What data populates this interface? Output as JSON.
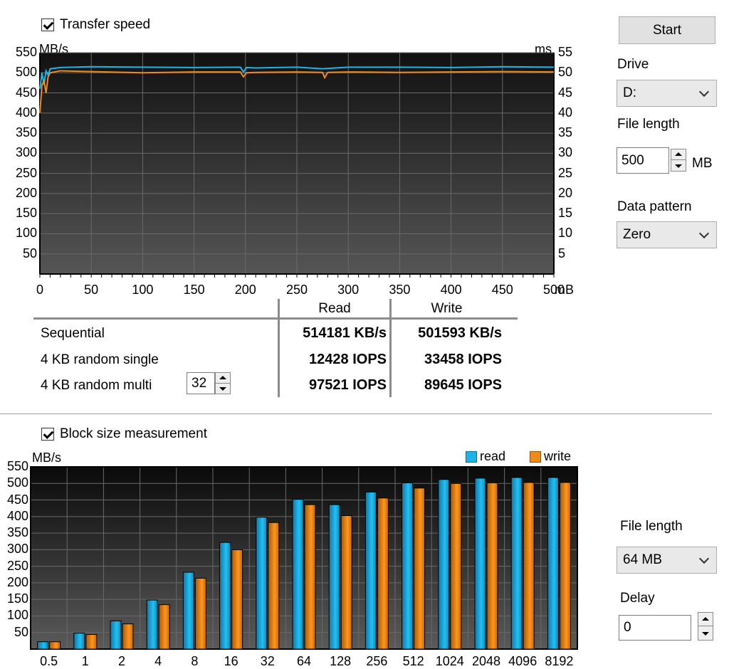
{
  "transfer": {
    "checkbox_label": "Transfer speed",
    "ylabel_left": "MB/s",
    "ylabel_right": "ms",
    "x_unit": "mB",
    "left_ticks": [
      "550",
      "500",
      "450",
      "400",
      "350",
      "300",
      "250",
      "200",
      "150",
      "100",
      "50"
    ],
    "right_ticks": [
      "55",
      "50",
      "45",
      "40",
      "35",
      "30",
      "25",
      "20",
      "15",
      "10",
      "5"
    ],
    "x_ticks": [
      "0",
      "50",
      "100",
      "150",
      "200",
      "250",
      "300",
      "350",
      "400",
      "450",
      "500"
    ]
  },
  "results": {
    "read_header": "Read",
    "write_header": "Write",
    "rows": [
      {
        "label": "Sequential",
        "read": "514181 KB/s",
        "write": "501593 KB/s"
      },
      {
        "label": "4 KB random single",
        "read": "12428 IOPS",
        "write": "33458 IOPS"
      },
      {
        "label": "4 KB random multi",
        "read": "97521 IOPS",
        "write": "89645 IOPS"
      }
    ],
    "queue_depth": "32"
  },
  "controls": {
    "start_label": "Start",
    "drive_label": "Drive",
    "drive_value": "D:",
    "file_length_label": "File length",
    "file_length_value": "500",
    "file_length_unit": "MB",
    "data_pattern_label": "Data pattern",
    "data_pattern_value": "Zero"
  },
  "block": {
    "checkbox_label": "Block size measurement",
    "ylabel": "MB/s",
    "legend_read": "read",
    "legend_write": "write",
    "file_length_label": "File length",
    "file_length_value": "64 MB",
    "delay_label": "Delay",
    "delay_value": "0",
    "y_ticks": [
      "550",
      "500",
      "450",
      "400",
      "350",
      "300",
      "250",
      "200",
      "150",
      "100",
      "50"
    ]
  },
  "colors": {
    "read": "#1fb4e8",
    "write": "#f08a1a",
    "plot_bg": "#2a2a2a",
    "grid": "#6a6a6a"
  },
  "chart_data": [
    {
      "type": "line",
      "xlabel": "mB",
      "ylabel": "MB/s",
      "ylabel_right": "ms",
      "xlim": [
        0,
        500
      ],
      "ylim": [
        0,
        550
      ],
      "grid": true,
      "series": [
        {
          "name": "read",
          "x": [
            0,
            2,
            4,
            6,
            8,
            10,
            20,
            50,
            100,
            150,
            195,
            198,
            201,
            210,
            250,
            275,
            300,
            350,
            400,
            450,
            500
          ],
          "y": [
            460,
            500,
            470,
            505,
            495,
            510,
            513,
            515,
            514,
            513,
            514,
            502,
            513,
            512,
            514,
            510,
            514,
            514,
            513,
            515,
            514
          ]
        },
        {
          "name": "write",
          "x": [
            0,
            2,
            4,
            6,
            8,
            10,
            20,
            50,
            100,
            150,
            195,
            198,
            201,
            210,
            250,
            275,
            277,
            280,
            300,
            350,
            400,
            450,
            500
          ],
          "y": [
            400,
            470,
            480,
            450,
            490,
            500,
            505,
            503,
            500,
            502,
            502,
            490,
            500,
            501,
            502,
            501,
            488,
            501,
            502,
            501,
            502,
            503,
            502
          ]
        }
      ]
    },
    {
      "type": "bar",
      "ylabel": "MB/s",
      "ylim": [
        0,
        550
      ],
      "grid": true,
      "legend": "top-right",
      "categories": [
        "0.5",
        "1",
        "2",
        "4",
        "8",
        "16",
        "32",
        "64",
        "128",
        "256",
        "512",
        "1024",
        "2048",
        "4096",
        "8192"
      ],
      "series": [
        {
          "name": "read",
          "values": [
            22,
            48,
            85,
            148,
            232,
            322,
            398,
            452,
            436,
            474,
            502,
            512,
            516,
            518,
            518
          ]
        },
        {
          "name": "write",
          "values": [
            22,
            44,
            76,
            134,
            214,
            300,
            382,
            436,
            403,
            456,
            486,
            500,
            502,
            503,
            503
          ]
        }
      ]
    }
  ]
}
